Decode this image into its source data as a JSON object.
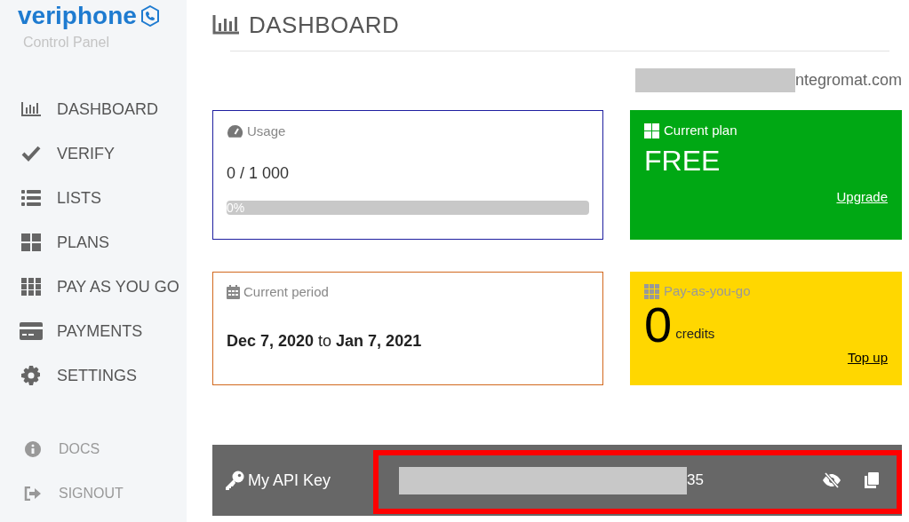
{
  "brand": {
    "name": "veriphone",
    "subtitle": "Control Panel"
  },
  "sidebar": {
    "items": [
      {
        "label": "DASHBOARD",
        "kind": "main"
      },
      {
        "label": "VERIFY",
        "kind": "main"
      },
      {
        "label": "LISTS",
        "kind": "main"
      },
      {
        "label": "PLANS",
        "kind": "main"
      },
      {
        "label": "PAY AS YOU GO",
        "kind": "main"
      },
      {
        "label": "PAYMENTS",
        "kind": "main"
      },
      {
        "label": "SETTINGS",
        "kind": "main"
      },
      {
        "label": "DOCS",
        "kind": "footer"
      },
      {
        "label": "SIGNOUT",
        "kind": "footer"
      }
    ]
  },
  "page_title": "DASHBOARD",
  "account_email": {
    "visible_text": "ntegromat.com",
    "redacted": true
  },
  "usage": {
    "title": "Usage",
    "count": "0 / 1 000",
    "level": 0,
    "percent_label": "0%"
  },
  "plan": {
    "title": "Current plan",
    "name": "FREE",
    "link": "Upgrade"
  },
  "period": {
    "title": "Current period",
    "from": "Dec 7, 2020",
    "joiner": "to",
    "to": "Jan 7, 2021"
  },
  "payg": {
    "title": "Pay-as-you-go",
    "amount": "0",
    "unit": "credits",
    "link": "Top up"
  },
  "api_key": {
    "label": "My API Key",
    "visible_text": "35",
    "redacted": true,
    "highlighted": true
  }
}
